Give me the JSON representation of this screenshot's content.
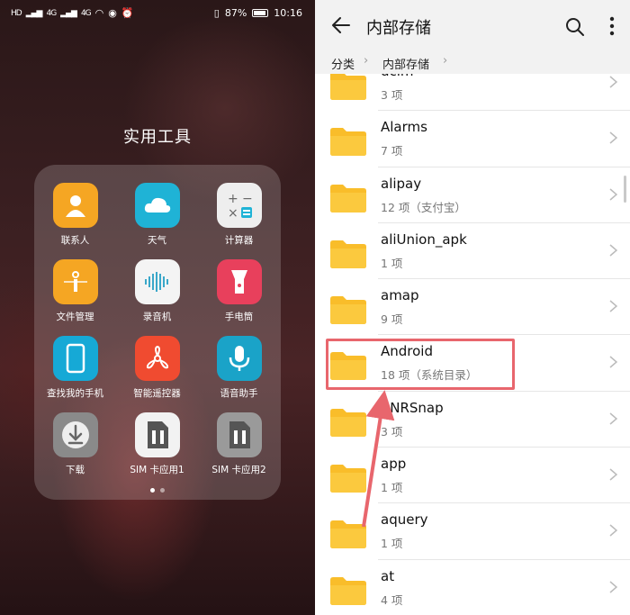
{
  "left_phone": {
    "statusbar": {
      "left_items": [
        "HD",
        "4G",
        "4G"
      ],
      "battery": "87%",
      "time": "10:16"
    },
    "folder_title": "实用工具",
    "apps": [
      {
        "label": "联系人",
        "icon": "contacts-icon",
        "color": "#f5a623"
      },
      {
        "label": "天气",
        "icon": "weather-icon",
        "color": "#1fb3d6"
      },
      {
        "label": "计算器",
        "icon": "calculator-icon",
        "color": "#eeeeee"
      },
      {
        "label": "文件管理",
        "icon": "file-manager-icon",
        "color": "#f5a623"
      },
      {
        "label": "录音机",
        "icon": "recorder-icon",
        "color": "#f4f4f4"
      },
      {
        "label": "手电筒",
        "icon": "flashlight-icon",
        "color": "#e8405c"
      },
      {
        "label": "查找我的手机",
        "icon": "find-phone-icon",
        "color": "#16a9d6"
      },
      {
        "label": "智能遥控器",
        "icon": "remote-icon",
        "color": "#f04b30"
      },
      {
        "label": "语音助手",
        "icon": "voice-assistant-icon",
        "color": "#1aa3c8"
      },
      {
        "label": "下载",
        "icon": "download-icon",
        "color": "#8a8a8a"
      },
      {
        "label": "SIM 卡应用1",
        "icon": "sim-card-icon",
        "color": "#f2f2f2"
      },
      {
        "label": "SIM 卡应用2",
        "icon": "sim-card-icon",
        "color": "#9a9a9a"
      }
    ],
    "page_dots": 2,
    "active_dot": 0
  },
  "right_phone": {
    "title": "内部存储",
    "breadcrumb": [
      "分类",
      "内部存储"
    ],
    "rows": [
      {
        "name": "dcim",
        "meta": "3 项"
      },
      {
        "name": "Alarms",
        "meta": "7 项"
      },
      {
        "name": "alipay",
        "meta": "12 项（支付宝）"
      },
      {
        "name": "aliUnion_apk",
        "meta": "1 项"
      },
      {
        "name": "amap",
        "meta": "9 项"
      },
      {
        "name": "Android",
        "meta": "18 项（系统目录）"
      },
      {
        "name": "ANRSnap",
        "meta": "3 项"
      },
      {
        "name": "app",
        "meta": "1 项"
      },
      {
        "name": "aquery",
        "meta": "1 项"
      },
      {
        "name": "at",
        "meta": "4 项"
      }
    ],
    "highlighted_row": "Android",
    "folder_color": "#f9bd2a",
    "annotation_color": "#e8666d"
  }
}
